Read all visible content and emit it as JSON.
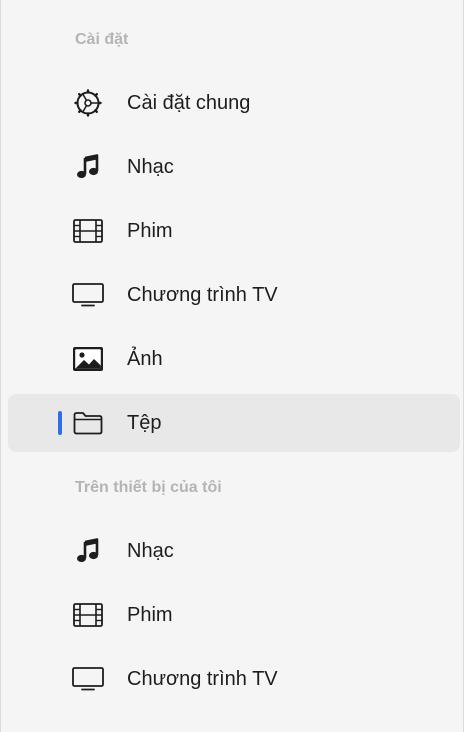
{
  "sections": [
    {
      "header": "Cài đặt",
      "items": [
        {
          "label": "Cài đặt chung",
          "icon": "gear-icon"
        },
        {
          "label": "Nhạc",
          "icon": "music-note-icon"
        },
        {
          "label": "Phim",
          "icon": "film-icon"
        },
        {
          "label": "Chương trình TV",
          "icon": "tv-icon"
        },
        {
          "label": "Ảnh",
          "icon": "photo-icon"
        },
        {
          "label": "Tệp",
          "icon": "folder-icon",
          "selected": true
        }
      ]
    },
    {
      "header": "Trên thiết bị của tôi",
      "items": [
        {
          "label": "Nhạc",
          "icon": "music-note-icon"
        },
        {
          "label": "Phim",
          "icon": "film-icon"
        },
        {
          "label": "Chương trình TV",
          "icon": "tv-icon"
        }
      ]
    }
  ],
  "colors": {
    "selection_indicator": "#2f6fe6",
    "section_header": "#b4b4b4",
    "selected_background": "#e8e8e8"
  }
}
